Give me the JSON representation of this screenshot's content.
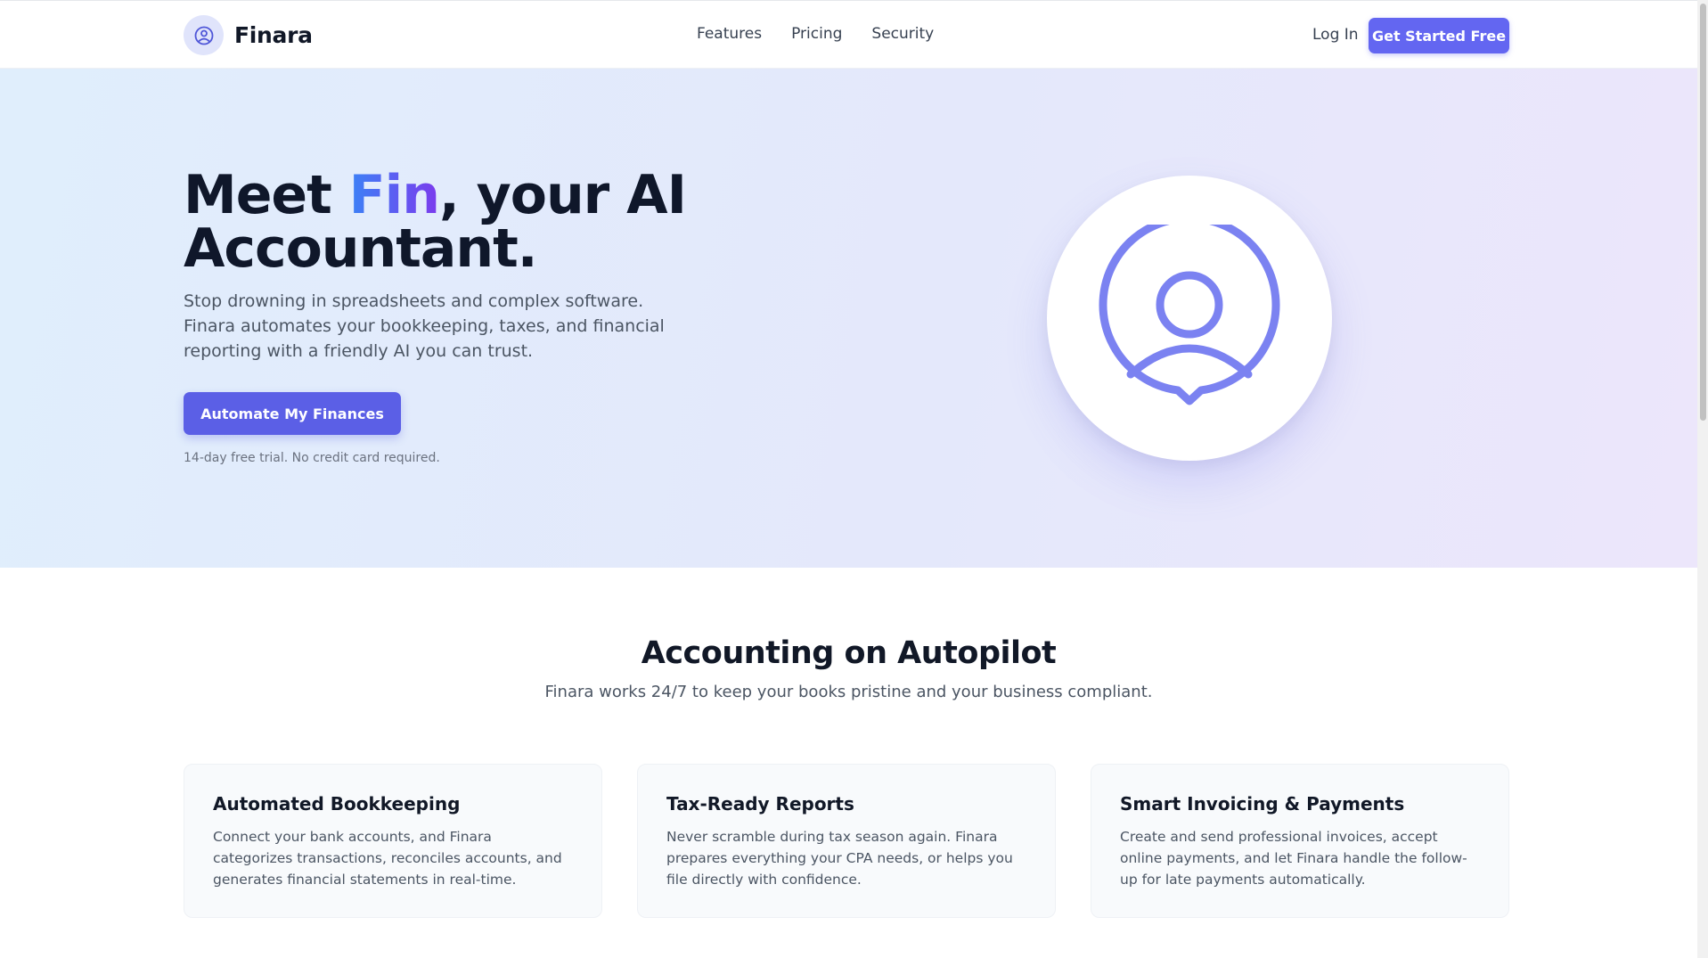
{
  "header": {
    "brand_name": "Finara",
    "nav": [
      {
        "label": "Features"
      },
      {
        "label": "Pricing"
      },
      {
        "label": "Security"
      }
    ],
    "login_label": "Log In",
    "cta_label": "Get Started Free"
  },
  "hero": {
    "title_prefix": "Meet ",
    "title_accent": "Fin",
    "title_suffix": ", your AI Accountant.",
    "subtitle": "Stop drowning in spreadsheets and complex software. Finara automates your bookkeeping, taxes, and financial reporting with a friendly AI you can trust.",
    "cta_label": "Automate My Finances",
    "note": "14-day free trial. No credit card required.",
    "illustration_icon": "user-avatar-icon"
  },
  "features": {
    "title": "Accounting on Autopilot",
    "subtitle": "Finara works 24/7 to keep your books pristine and your business compliant.",
    "cards": [
      {
        "title": "Automated Bookkeeping",
        "text": "Connect your bank accounts, and Finara categorizes transactions, reconciles accounts, and generates financial statements in real-time."
      },
      {
        "title": "Tax-Ready Reports",
        "text": "Never scramble during tax season again. Finara prepares everything your CPA needs, or helps you file directly with confidence."
      },
      {
        "title": "Smart Invoicing & Payments",
        "text": "Create and send professional invoices, accept online payments, and let Finara handle the follow-up for late payments automatically."
      }
    ]
  },
  "colors": {
    "primary": "#6366f1",
    "accent_gradient_start": "#3b82f6",
    "accent_gradient_end": "#7c3aed",
    "heading": "#0f172a",
    "body_text": "#4b5563"
  }
}
